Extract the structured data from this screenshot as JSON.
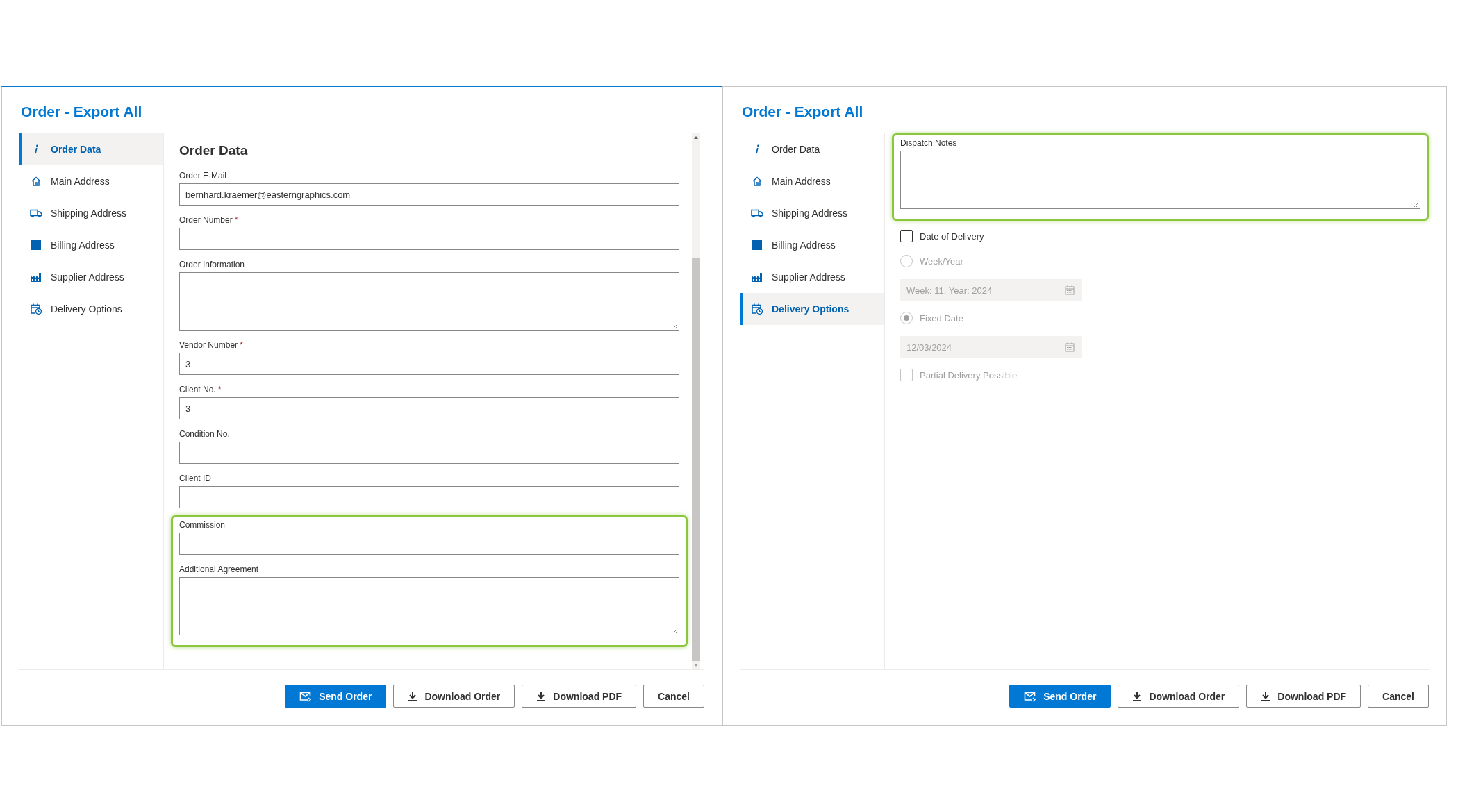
{
  "dialogs": [
    {
      "title": "Order - Export All",
      "focused": true,
      "scrollbar": true,
      "nav": [
        {
          "label": "Order Data",
          "selected": true
        },
        {
          "label": "Main Address",
          "selected": false
        },
        {
          "label": "Shipping Address",
          "selected": false
        },
        {
          "label": "Billing Address",
          "selected": false
        },
        {
          "label": "Supplier Address",
          "selected": false
        },
        {
          "label": "Delivery Options",
          "selected": false
        }
      ],
      "content": {
        "heading": "Order Data",
        "sections": [
          {
            "kind": "plain",
            "fields": [
              {
                "kind": "text",
                "label": "Order E-Mail",
                "value": "bernhard.kraemer@easterngraphics.com"
              },
              {
                "kind": "text",
                "label": "Order Number",
                "required_mark": "*"
              },
              {
                "kind": "textarea",
                "label": "Order Information"
              },
              {
                "kind": "text",
                "label": "Vendor Number",
                "required_mark": "*",
                "value": "3"
              },
              {
                "kind": "text",
                "label": "Client No.",
                "required_mark": "*",
                "value": "3"
              },
              {
                "kind": "text",
                "label": "Condition No."
              },
              {
                "kind": "text",
                "label": "Client ID"
              }
            ]
          },
          {
            "kind": "highlighted",
            "fields": [
              {
                "kind": "text",
                "label": "Commission"
              },
              {
                "kind": "textarea",
                "label": "Additional Agreement"
              }
            ]
          }
        ]
      },
      "buttons": [
        {
          "label": "Send Order",
          "kind": "send"
        },
        {
          "label": "Download Order",
          "kind": "download"
        },
        {
          "label": "Download PDF",
          "kind": "download"
        },
        {
          "label": "Cancel",
          "kind": "cancel"
        }
      ]
    },
    {
      "title": "Order - Export All",
      "focused": false,
      "nav": [
        {
          "label": "Order Data",
          "selected": false
        },
        {
          "label": "Main Address",
          "selected": false
        },
        {
          "label": "Shipping Address",
          "selected": false
        },
        {
          "label": "Billing Address",
          "selected": false
        },
        {
          "label": "Supplier Address",
          "selected": false
        },
        {
          "label": "Delivery Options",
          "selected": true
        }
      ],
      "content": {
        "sections": [
          {
            "kind": "highlighted",
            "fields": [
              {
                "kind": "textarea",
                "label": "Dispatch Notes"
              }
            ]
          },
          {
            "kind": "plain",
            "fields": [
              {
                "kind": "checkbox",
                "label": "Date of Delivery",
                "checked": false,
                "disabled": false
              },
              {
                "kind": "radio",
                "label": "Week/Year",
                "selected": false,
                "disabled": true
              },
              {
                "kind": "date",
                "value": "Week: 11, Year: 2024",
                "disabled": true
              },
              {
                "kind": "radio",
                "label": "Fixed Date",
                "selected": true,
                "disabled": true
              },
              {
                "kind": "date",
                "value": "12/03/2024",
                "disabled": true
              },
              {
                "kind": "checkbox",
                "label": "Partial Delivery Possible",
                "checked": false,
                "disabled": true
              }
            ]
          }
        ]
      },
      "buttons": [
        {
          "label": "Send Order",
          "kind": "send"
        },
        {
          "label": "Download Order",
          "kind": "download"
        },
        {
          "label": "Download PDF",
          "kind": "download"
        },
        {
          "label": "Cancel",
          "kind": "cancel"
        }
      ]
    }
  ]
}
